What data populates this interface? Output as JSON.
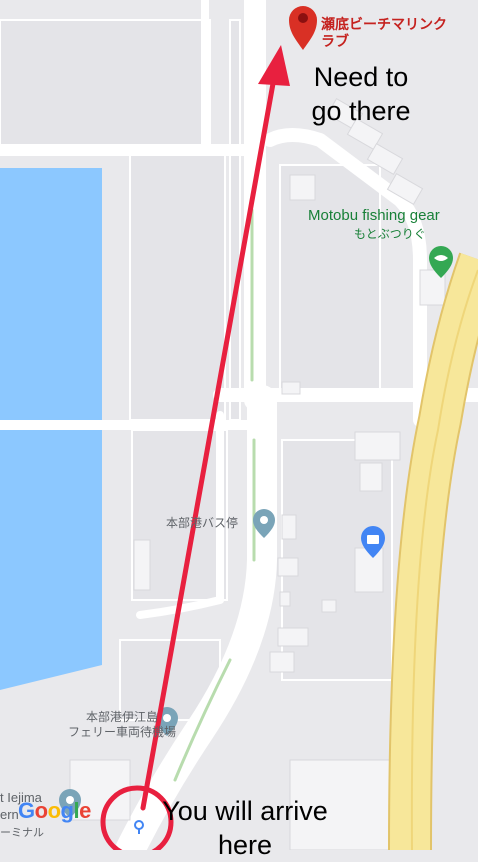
{
  "destination": {
    "name": "瀬底ビーチマリンクラブ",
    "line1": "瀬底ビーチマリンク",
    "line2": "ラブ"
  },
  "pois": {
    "fishing": {
      "name": "Motobu fishing gear",
      "sub": "もとぶつりぐ"
    },
    "bus_stop": {
      "name": "本部港バス停"
    },
    "ferry": {
      "line1": "本部港伊江島",
      "line2": "フェリー車両待機場"
    },
    "terminal": {
      "line1": "t Iejima",
      "line2": "ern",
      "line3": "ーミナル"
    }
  },
  "annotations": {
    "goal": {
      "line1": "Need to",
      "line2": "go there"
    },
    "arrival": {
      "line1": "You will arrive",
      "line2": "here"
    }
  },
  "logo": {
    "letters": [
      "G",
      "o",
      "o",
      "g",
      "l",
      "e"
    ],
    "colors": [
      "#4285f4",
      "#ea4335",
      "#fbbc05",
      "#4285f4",
      "#34a853",
      "#ea4335"
    ]
  },
  "colors": {
    "water": "#8cc8ff",
    "land": "#e9e9ec",
    "road": "#ffffff",
    "highway": "#f7e79a",
    "arrow": "#e8203f",
    "pin": "#d93025",
    "green_poi": "#188038",
    "blue_poi": "#4285f4",
    "gray_poi": "#7aa4b8"
  }
}
